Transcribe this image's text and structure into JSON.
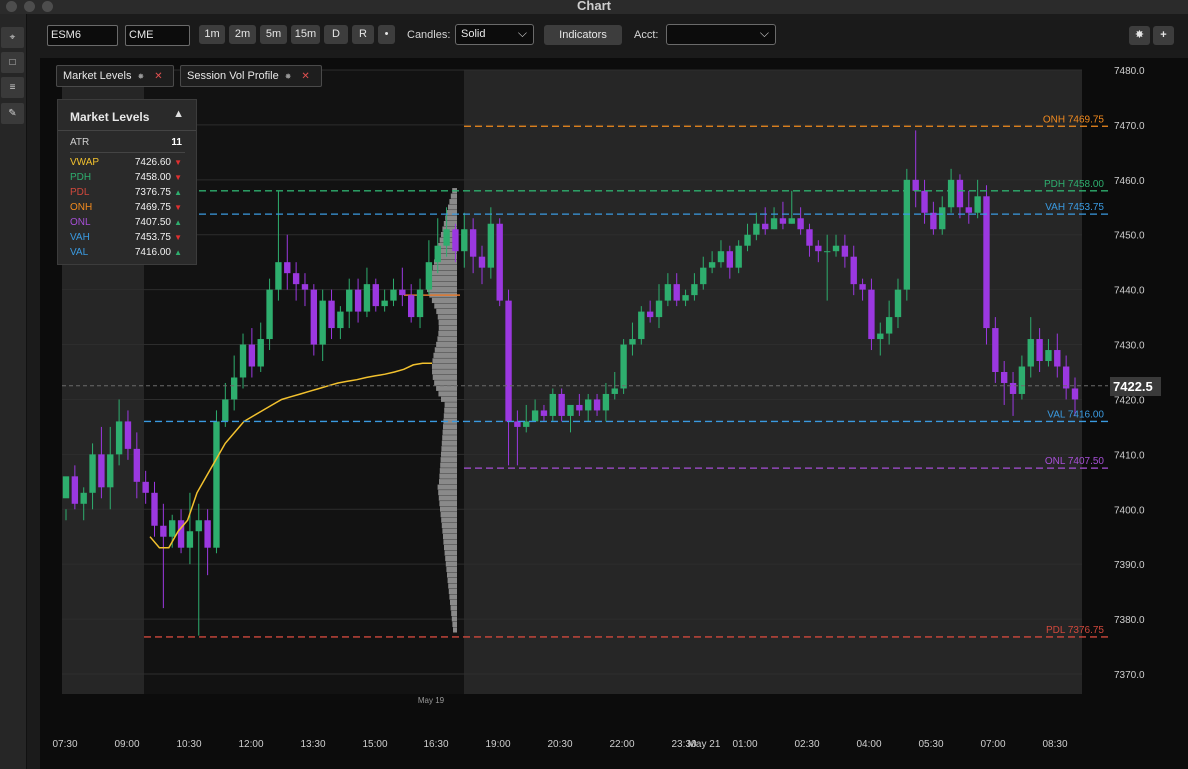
{
  "window": {
    "title": "Chart"
  },
  "toolbar": {
    "symbol_value": "ESM6",
    "exchange_value": "CME",
    "timeframes": [
      "1m",
      "2m",
      "5m",
      "15m",
      "D",
      "R",
      "•"
    ],
    "candles_label": "Candles:",
    "candles_value": "Solid",
    "indicators_label": "Indicators",
    "acct_label": "Acct:",
    "acct_value": ""
  },
  "indicator_tabs": [
    {
      "label": "Market Levels"
    },
    {
      "label": "Session Vol Profile"
    }
  ],
  "market_levels_panel": {
    "title": "Market Levels",
    "atr_label": "ATR",
    "atr_value": "11",
    "levels": [
      {
        "name": "VWAP",
        "value": "7426.60",
        "direction": "down",
        "color": "#f2c12e"
      },
      {
        "name": "PDH",
        "value": "7458.00",
        "direction": "down",
        "color": "#2eae6e"
      },
      {
        "name": "PDL",
        "value": "7376.75",
        "direction": "up",
        "color": "#d0483c"
      },
      {
        "name": "ONH",
        "value": "7469.75",
        "direction": "down",
        "color": "#f28a1e"
      },
      {
        "name": "ONL",
        "value": "7407.50",
        "direction": "up",
        "color": "#a64fd6"
      },
      {
        "name": "VAH",
        "value": "7453.75",
        "direction": "down",
        "color": "#3a9ae0"
      },
      {
        "name": "VAL",
        "value": "7416.00",
        "direction": "up",
        "color": "#3a9ae0"
      }
    ]
  },
  "chart_data": {
    "type": "candlestick",
    "symbol": "ESM6",
    "ylim": [
      7370,
      7480
    ],
    "y_ticks": [
      "7480.0",
      "7470.0",
      "7460.0",
      "7450.0",
      "7440.0",
      "7430.0",
      "7420.0",
      "7410.0",
      "7400.0",
      "7390.0",
      "7380.0",
      "7370.0"
    ],
    "x_ticks": [
      "07:30",
      "09:00",
      "10:30",
      "12:00",
      "13:30",
      "15:00",
      "16:30",
      "19:00",
      "20:30",
      "22:00",
      "23:30",
      "May 21",
      "01:00",
      "02:30",
      "04:00",
      "05:30",
      "07:00",
      "08:30"
    ],
    "session_label": "May 19",
    "last_price": "7422.5",
    "last_price_value": 7422.5,
    "up_color": "#2eae6e",
    "down_color": "#9b38e0",
    "levels": [
      {
        "label": "ONH 7469.75",
        "value": 7469.75,
        "color": "#f28a1e"
      },
      {
        "label": "PDH 7458.00",
        "value": 7458.0,
        "color": "#2eae6e"
      },
      {
        "label": "VAH 7453.75",
        "value": 7453.75,
        "color": "#3a9ae0"
      },
      {
        "label": "VAL 7416.00",
        "value": 7416.0,
        "color": "#3a9ae0"
      },
      {
        "label": "ONL 7407.50",
        "value": 7407.5,
        "color": "#a64fd6"
      },
      {
        "label": "PDL 7376.75",
        "value": 7376.75,
        "color": "#d0483c"
      }
    ],
    "vwap": [
      7395,
      7393,
      7393,
      7396,
      7398,
      7403,
      7406,
      7409,
      7412,
      7414,
      7416,
      7417,
      7418,
      7419,
      7420,
      7420.5,
      7421,
      7421.5,
      7422,
      7422.5,
      7423,
      7423.3,
      7423.6,
      7424,
      7424.3,
      7424.6,
      7425,
      7425.5,
      7426.3,
      7426.6,
      7426.6
    ],
    "candles": [
      [
        7402,
        7406,
        7400,
        7398
      ],
      [
        7406,
        7401,
        7408,
        7400
      ],
      [
        7401,
        7403,
        7404,
        7398
      ],
      [
        7403,
        7410,
        7412,
        7400
      ],
      [
        7410,
        7404,
        7415,
        7402
      ],
      [
        7404,
        7410,
        7415,
        7400
      ],
      [
        7410,
        7416,
        7420,
        7408
      ],
      [
        7416,
        7411,
        7418,
        7409
      ],
      [
        7411,
        7405,
        7414,
        7402
      ],
      [
        7405,
        7403,
        7407,
        7401
      ],
      [
        7403,
        7397,
        7405,
        7395
      ],
      [
        7397,
        7395,
        7401,
        7382
      ],
      [
        7395,
        7398,
        7399,
        7393
      ],
      [
        7398,
        7393,
        7400,
        7392
      ],
      [
        7393,
        7396,
        7403,
        7390
      ],
      [
        7396,
        7398,
        7401,
        7377
      ],
      [
        7398,
        7393,
        7400,
        7388
      ],
      [
        7393,
        7416,
        7418,
        7392
      ],
      [
        7416,
        7420,
        7423,
        7415
      ],
      [
        7420,
        7424,
        7428,
        7418
      ],
      [
        7424,
        7430,
        7432,
        7422
      ],
      [
        7430,
        7426,
        7433,
        7424
      ],
      [
        7426,
        7431,
        7434,
        7425
      ],
      [
        7431,
        7440,
        7442,
        7429
      ],
      [
        7440,
        7445,
        7458,
        7438
      ],
      [
        7445,
        7443,
        7450,
        7440
      ],
      [
        7443,
        7441,
        7445,
        7438
      ],
      [
        7441,
        7440,
        7443,
        7437
      ],
      [
        7440,
        7430,
        7441,
        7428
      ],
      [
        7430,
        7438,
        7440,
        7427
      ],
      [
        7438,
        7433,
        7440,
        7431
      ],
      [
        7433,
        7436,
        7437,
        7431
      ],
      [
        7436,
        7440,
        7442,
        7433
      ],
      [
        7440,
        7436,
        7442,
        7434
      ],
      [
        7436,
        7441,
        7444,
        7435
      ],
      [
        7441,
        7437,
        7442,
        7436
      ],
      [
        7437,
        7438,
        7440,
        7436
      ],
      [
        7438,
        7440,
        7442,
        7437
      ],
      [
        7440,
        7439,
        7444,
        7437
      ],
      [
        7439,
        7435,
        7441,
        7434
      ],
      [
        7435,
        7440,
        7442,
        7433
      ],
      [
        7440,
        7445,
        7449,
        7439
      ],
      [
        7445,
        7448,
        7453,
        7443
      ],
      [
        7448,
        7451,
        7455,
        7446
      ],
      [
        7451,
        7447,
        7452,
        7445
      ],
      [
        7447,
        7451,
        7454,
        7444
      ],
      [
        7451,
        7446,
        7453,
        7443
      ],
      [
        7446,
        7444,
        7448,
        7441
      ],
      [
        7444,
        7452,
        7455,
        7442
      ],
      [
        7452,
        7438,
        7453,
        7437
      ],
      [
        7438,
        7416,
        7440,
        7408
      ],
      [
        7416,
        7415,
        7418,
        7408
      ],
      [
        7415,
        7416,
        7419,
        7414
      ],
      [
        7416,
        7418,
        7420,
        7416
      ],
      [
        7418,
        7417,
        7419,
        7416
      ],
      [
        7417,
        7421,
        7422,
        7416
      ],
      [
        7421,
        7417,
        7422,
        7416
      ],
      [
        7417,
        7419,
        7419,
        7414
      ],
      [
        7419,
        7418,
        7421,
        7417
      ],
      [
        7418,
        7420,
        7421,
        7416
      ],
      [
        7420,
        7418,
        7421,
        7417
      ],
      [
        7418,
        7421,
        7423,
        7416
      ],
      [
        7421,
        7422,
        7425,
        7420
      ],
      [
        7422,
        7430,
        7431,
        7421
      ],
      [
        7430,
        7431,
        7434,
        7428
      ],
      [
        7431,
        7436,
        7437,
        7430
      ],
      [
        7436,
        7435,
        7438,
        7434
      ],
      [
        7435,
        7438,
        7441,
        7433
      ],
      [
        7438,
        7441,
        7443,
        7437
      ],
      [
        7441,
        7438,
        7443,
        7437
      ],
      [
        7438,
        7439,
        7440,
        7437
      ],
      [
        7439,
        7441,
        7443,
        7438
      ],
      [
        7441,
        7444,
        7446,
        7440
      ],
      [
        7444,
        7445,
        7447,
        7443
      ],
      [
        7445,
        7447,
        7449,
        7444
      ],
      [
        7447,
        7444,
        7448,
        7442
      ],
      [
        7444,
        7448,
        7449,
        7443
      ],
      [
        7448,
        7450,
        7452,
        7447
      ],
      [
        7450,
        7452,
        7454,
        7449
      ],
      [
        7452,
        7451,
        7455,
        7450
      ],
      [
        7451,
        7453,
        7455,
        7451
      ],
      [
        7453,
        7452,
        7456,
        7451
      ],
      [
        7452,
        7453,
        7458,
        7452
      ],
      [
        7453,
        7451,
        7455,
        7450
      ],
      [
        7451,
        7448,
        7452,
        7446
      ],
      [
        7448,
        7447,
        7449,
        7445
      ],
      [
        7447,
        7447,
        7450,
        7438
      ],
      [
        7447,
        7448,
        7450,
        7446
      ],
      [
        7448,
        7446,
        7450,
        7444
      ],
      [
        7446,
        7441,
        7448,
        7439
      ],
      [
        7441,
        7440,
        7442,
        7438
      ],
      [
        7440,
        7431,
        7442,
        7429
      ],
      [
        7431,
        7432,
        7434,
        7428
      ],
      [
        7432,
        7435,
        7438,
        7430
      ],
      [
        7435,
        7440,
        7442,
        7433
      ],
      [
        7440,
        7460,
        7462,
        7438
      ],
      [
        7460,
        7458,
        7469,
        7455
      ],
      [
        7458,
        7454,
        7460,
        7452
      ],
      [
        7454,
        7451,
        7456,
        7450
      ],
      [
        7451,
        7455,
        7457,
        7450
      ],
      [
        7455,
        7460,
        7462,
        7454
      ],
      [
        7460,
        7455,
        7461,
        7453
      ],
      [
        7455,
        7454,
        7458,
        7452
      ],
      [
        7454,
        7457,
        7460,
        7453
      ],
      [
        7457,
        7433,
        7459,
        7430
      ],
      [
        7433,
        7425,
        7435,
        7423
      ],
      [
        7425,
        7423,
        7427,
        7419
      ],
      [
        7423,
        7421,
        7425,
        7417
      ],
      [
        7421,
        7426,
        7428,
        7420
      ],
      [
        7426,
        7431,
        7435,
        7424
      ],
      [
        7431,
        7427,
        7433,
        7425
      ],
      [
        7427,
        7429,
        7431,
        7426
      ],
      [
        7429,
        7426,
        7432,
        7424
      ],
      [
        7426,
        7422,
        7428,
        7420
      ],
      [
        7422,
        7420,
        7424,
        7417
      ]
    ]
  }
}
